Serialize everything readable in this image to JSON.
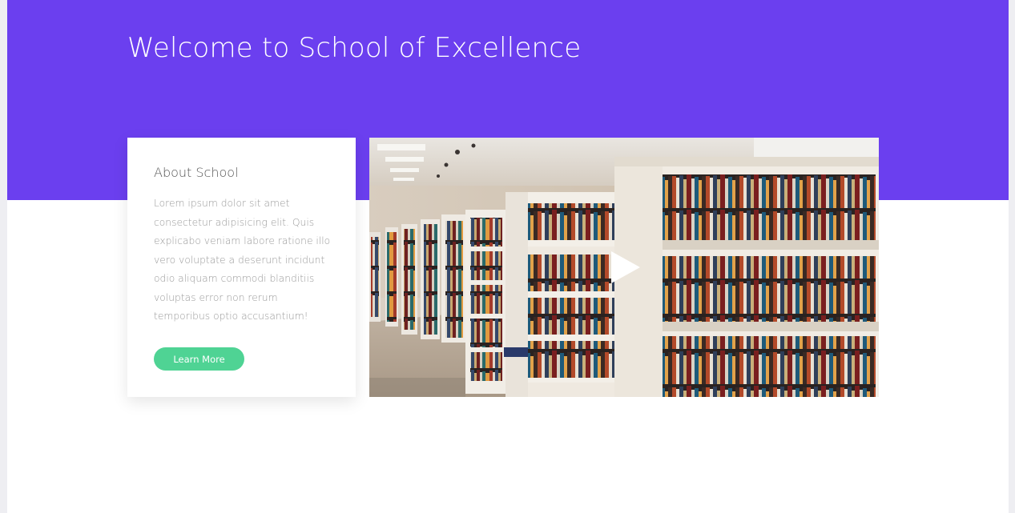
{
  "hero": {
    "title": "Welcome to School of Excellence",
    "background_color": "#6b3fef"
  },
  "about": {
    "title": "About School",
    "body": "Lorem ipsum dolor sit amet consectetur adipisicing elit. Quis explicabo veniam labore ratione illo vero voluptate a deserunt incidunt odio aliquam commodi blanditiis voluptas error non rerum temporibus optio accusantium!",
    "button_label": "Learn More",
    "button_color": "#4fd394"
  },
  "video": {
    "thumbnail_subject": "library bookshelves",
    "play_icon": "play-icon"
  }
}
